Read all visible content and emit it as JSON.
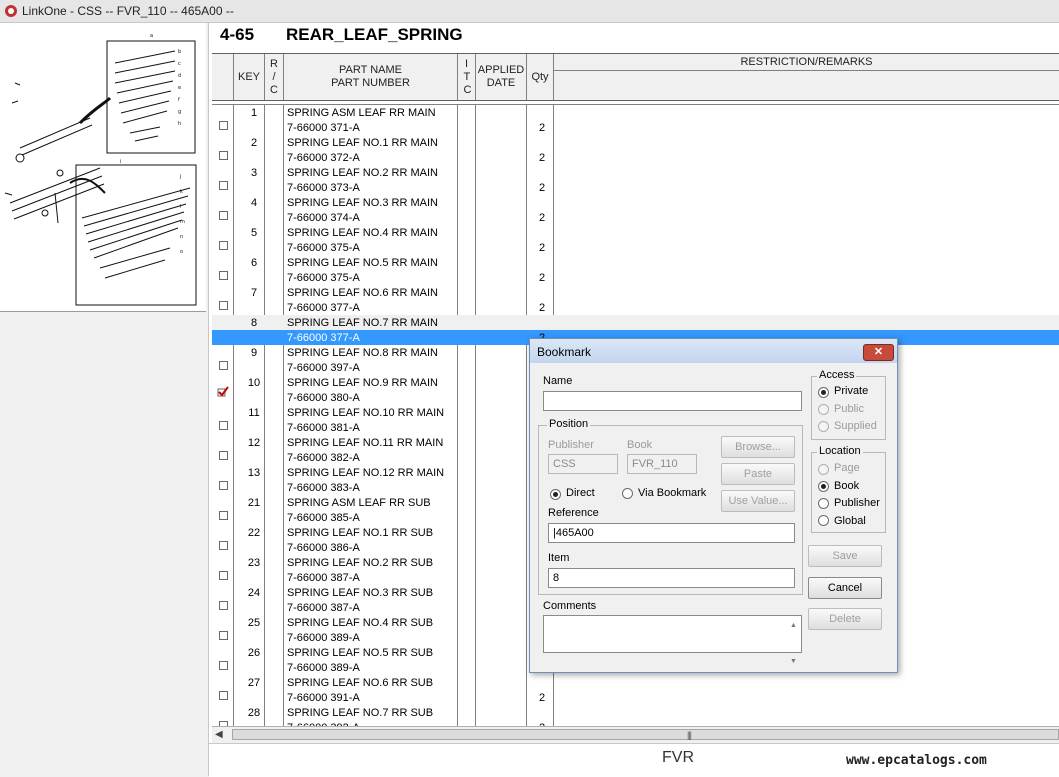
{
  "window": {
    "title": "LinkOne - CSS -- FVR_110 -- 465A00 --"
  },
  "page": {
    "number": "4-65",
    "name": "REAR_LEAF_SPRING"
  },
  "columns": {
    "key": "KEY",
    "rc": "R / C",
    "part_name": "PART NAME",
    "part_number": "PART NUMBER",
    "itc": "I T C",
    "applied": "APPLIED",
    "date": "DATE",
    "qty": "Qty",
    "remarks": "RESTRICTION/REMARKS"
  },
  "rows": [
    {
      "key": "1",
      "name": "SPRING ASM LEAF RR MAIN",
      "number": "7-66000 371-A",
      "qty": "2"
    },
    {
      "key": "2",
      "name": "SPRING LEAF NO.1 RR MAIN",
      "number": "7-66000 372-A",
      "qty": "2"
    },
    {
      "key": "3",
      "name": "SPRING LEAF NO.2 RR MAIN",
      "number": "7-66000 373-A",
      "qty": "2"
    },
    {
      "key": "4",
      "name": "SPRING LEAF NO.3 RR MAIN",
      "number": "7-66000 374-A",
      "qty": "2"
    },
    {
      "key": "5",
      "name": "SPRING LEAF NO.4 RR MAIN",
      "number": "7-66000 375-A",
      "qty": "2"
    },
    {
      "key": "6",
      "name": "SPRING LEAF NO.5 RR MAIN",
      "number": "7-66000 375-A",
      "qty": "2"
    },
    {
      "key": "7",
      "name": "SPRING LEAF NO.6 RR MAIN",
      "number": "7-66000 377-A",
      "qty": "2"
    },
    {
      "key": "8",
      "name": "SPRING LEAF NO.7 RR MAIN",
      "number": "7-66000 377-A",
      "qty": "2"
    },
    {
      "key": "9",
      "name": "SPRING LEAF NO.8 RR MAIN",
      "number": "7-66000 397-A",
      "qty": ""
    },
    {
      "key": "10",
      "name": "SPRING LEAF NO.9 RR MAIN",
      "number": "7-66000 380-A",
      "qty": ""
    },
    {
      "key": "11",
      "name": "SPRING LEAF NO.10 RR MAIN",
      "number": "7-66000 381-A",
      "qty": ""
    },
    {
      "key": "12",
      "name": "SPRING LEAF NO.11 RR MAIN",
      "number": "7-66000 382-A",
      "qty": ""
    },
    {
      "key": "13",
      "name": "SPRING LEAF NO.12 RR MAIN",
      "number": "7-66000 383-A",
      "qty": ""
    },
    {
      "key": "21",
      "name": "SPRING ASM LEAF RR SUB",
      "number": "7-66000 385-A",
      "qty": ""
    },
    {
      "key": "22",
      "name": "SPRING LEAF NO.1 RR SUB",
      "number": "7-66000 386-A",
      "qty": ""
    },
    {
      "key": "23",
      "name": "SPRING LEAF NO.2 RR SUB",
      "number": "7-66000 387-A",
      "qty": ""
    },
    {
      "key": "24",
      "name": "SPRING LEAF NO.3 RR SUB",
      "number": "7-66000 387-A",
      "qty": ""
    },
    {
      "key": "25",
      "name": "SPRING LEAF NO.4 RR SUB",
      "number": "7-66000 389-A",
      "qty": ""
    },
    {
      "key": "26",
      "name": "SPRING LEAF NO.5 RR SUB",
      "number": "7-66000 389-A",
      "qty": ""
    },
    {
      "key": "27",
      "name": "SPRING LEAF NO.6 RR SUB",
      "number": "7-66000 391-A",
      "qty": "2"
    },
    {
      "key": "28",
      "name": "SPRING LEAF NO.7 RR SUB",
      "number": "7-66000 392-A",
      "qty": "2"
    }
  ],
  "footer": {
    "model": "FVR",
    "watermark": "www.epcatalogs.com"
  },
  "dialog": {
    "title": "Bookmark",
    "close": "✕",
    "name_label": "Name",
    "name_value": "",
    "position_label": "Position",
    "publisher_label": "Publisher",
    "publisher_value": "CSS",
    "book_label": "Book",
    "book_value": "FVR_110",
    "browse": "Browse...",
    "paste": "Paste",
    "use_value": "Use Value...",
    "direct": "Direct",
    "via_bookmark": "Via Bookmark",
    "reference_label": "Reference",
    "reference_value": "|465A00",
    "item_label": "Item",
    "item_value": "8",
    "comments_label": "Comments",
    "access_label": "Access",
    "access_private": "Private",
    "access_public": "Public",
    "access_supplied": "Supplied",
    "location_label": "Location",
    "loc_page": "Page",
    "loc_book": "Book",
    "loc_publisher": "Publisher",
    "loc_global": "Global",
    "save": "Save",
    "cancel": "Cancel",
    "delete": "Delete"
  }
}
